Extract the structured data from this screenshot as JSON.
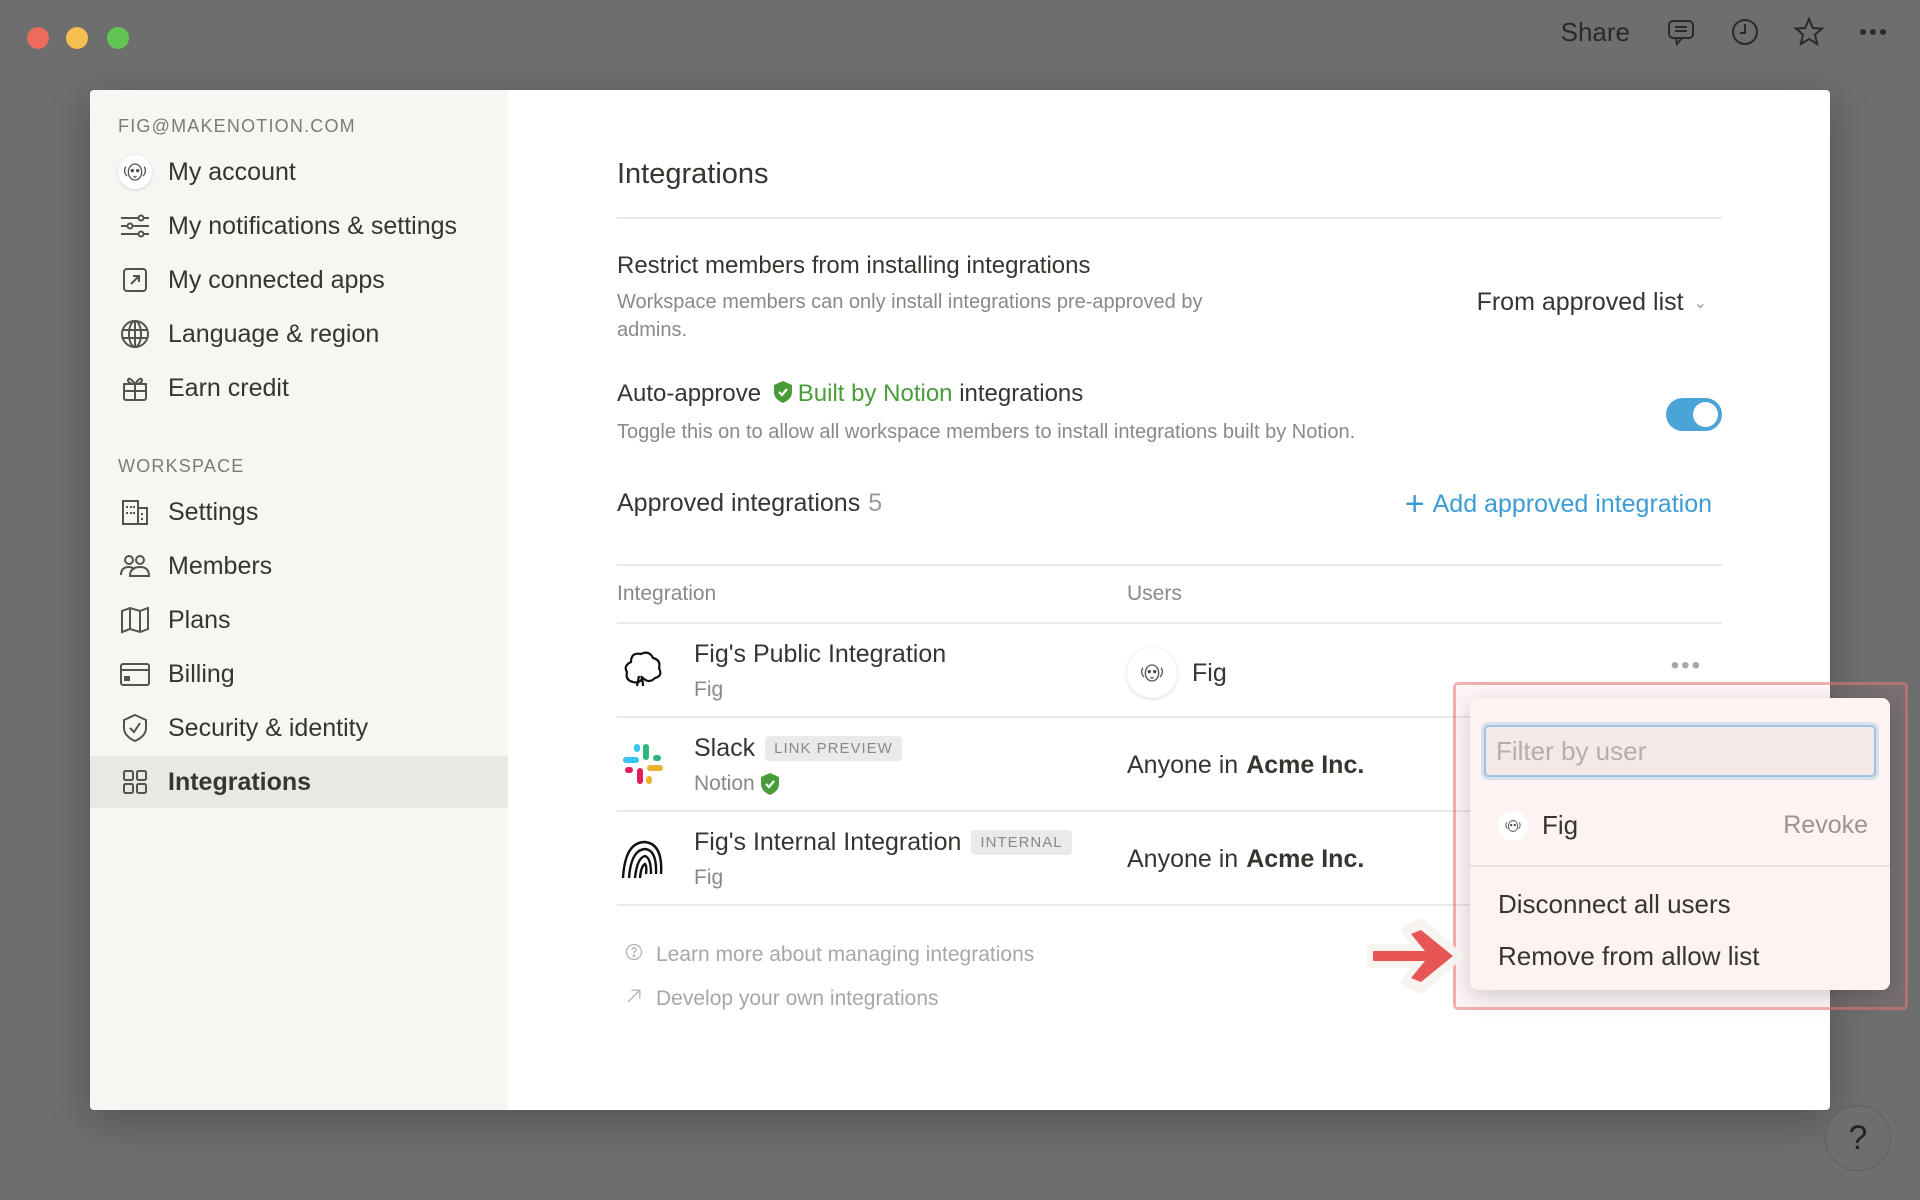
{
  "window": {
    "share_label": "Share",
    "toolbar_icons": [
      "comment-icon",
      "clock-icon",
      "star-icon",
      "more-icon"
    ]
  },
  "sidebar": {
    "account_section": "FIG@MAKENOTION.COM",
    "account_items": [
      {
        "label": "My account",
        "icon": "avatar-icon"
      },
      {
        "label": "My notifications & settings",
        "icon": "sliders-icon"
      },
      {
        "label": "My connected apps",
        "icon": "external-link-icon"
      },
      {
        "label": "Language & region",
        "icon": "globe-icon"
      },
      {
        "label": "Earn credit",
        "icon": "gift-icon"
      }
    ],
    "workspace_section": "WORKSPACE",
    "workspace_items": [
      {
        "label": "Settings",
        "icon": "building-icon"
      },
      {
        "label": "Members",
        "icon": "people-icon"
      },
      {
        "label": "Plans",
        "icon": "map-icon"
      },
      {
        "label": "Billing",
        "icon": "credit-card-icon"
      },
      {
        "label": "Security & identity",
        "icon": "shield-icon"
      },
      {
        "label": "Integrations",
        "icon": "grid-icon",
        "active": true
      }
    ]
  },
  "main": {
    "title": "Integrations",
    "restrict": {
      "title": "Restrict members from installing integrations",
      "desc_line1": "Workspace members can only install integrations pre-approved by",
      "desc_line2": "admins.",
      "dropdown_value": "From approved list"
    },
    "auto_approve": {
      "title_prefix": "Auto-approve",
      "title_highlight": "Built by Notion",
      "title_suffix": "integrations",
      "desc": "Toggle this on to allow all workspace members to install integrations built by Notion.",
      "enabled": true
    },
    "approved": {
      "label": "Approved integrations",
      "count": "5",
      "add_label": "Add approved integration"
    },
    "columns": {
      "integration": "Integration",
      "users": "Users"
    },
    "rows": [
      {
        "name": "Fig's Public Integration",
        "tag": "",
        "sub": "Fig",
        "verified": false,
        "users_prefix": "",
        "users_name": "Fig",
        "icon": "fig-public-icon"
      },
      {
        "name": "Slack",
        "tag": "LINK PREVIEW",
        "sub": "Notion",
        "verified": true,
        "users_prefix": "Anyone in",
        "users_name": "Acme Inc.",
        "icon": "slack-icon"
      },
      {
        "name": "Fig's Internal Integration",
        "tag": "INTERNAL",
        "sub": "Fig",
        "verified": false,
        "users_prefix": "Anyone in",
        "users_name": "Acme Inc.",
        "icon": "fig-internal-icon"
      }
    ],
    "footer_links": [
      {
        "label": "Learn more about managing integrations",
        "icon": "help-circle-icon"
      },
      {
        "label": "Develop your own integrations",
        "icon": "arrow-up-right-icon"
      }
    ]
  },
  "popup": {
    "filter_placeholder": "Filter by user",
    "filter_value": "",
    "user_name": "Fig",
    "revoke_label": "Revoke",
    "actions": [
      "Disconnect all users",
      "Remove from allow list"
    ]
  },
  "help_label": "?",
  "colors": {
    "accent_blue": "#3d9bd6",
    "toggle_on": "#4aa4d8",
    "notion_green": "#4a9c3a",
    "annotation_red": "#e85555"
  }
}
